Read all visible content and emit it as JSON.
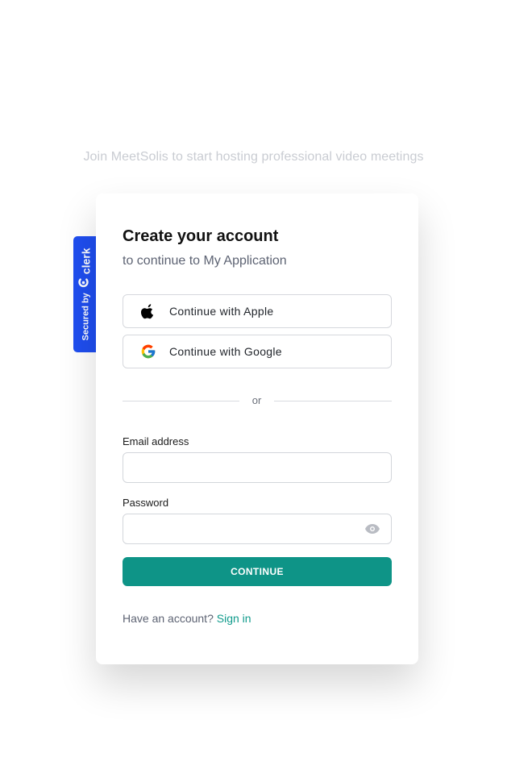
{
  "tagline": "Join MeetSolis to start hosting professional video meetings",
  "badge": {
    "secured_label": "Secured by",
    "brand": "clerk",
    "icon": "clerk-logo-icon",
    "color": "#1f4ef0"
  },
  "card": {
    "title": "Create your account",
    "subtitle": "to continue to My Application",
    "social": [
      {
        "label": "Continue with Apple",
        "icon": "apple-icon"
      },
      {
        "label": "Continue with Google",
        "icon": "google-icon"
      }
    ],
    "divider_text": "or",
    "email": {
      "label": "Email address",
      "value": "",
      "placeholder": ""
    },
    "password": {
      "label": "Password",
      "value": "",
      "placeholder": "",
      "toggle_icon": "eye-icon"
    },
    "continue_label": "CONTINUE",
    "footer": {
      "text": "Have an account?",
      "link": "Sign in"
    }
  },
  "colors": {
    "primary": "#0e9487",
    "link": "#109b8c",
    "tagline": "#c9ccd2"
  }
}
